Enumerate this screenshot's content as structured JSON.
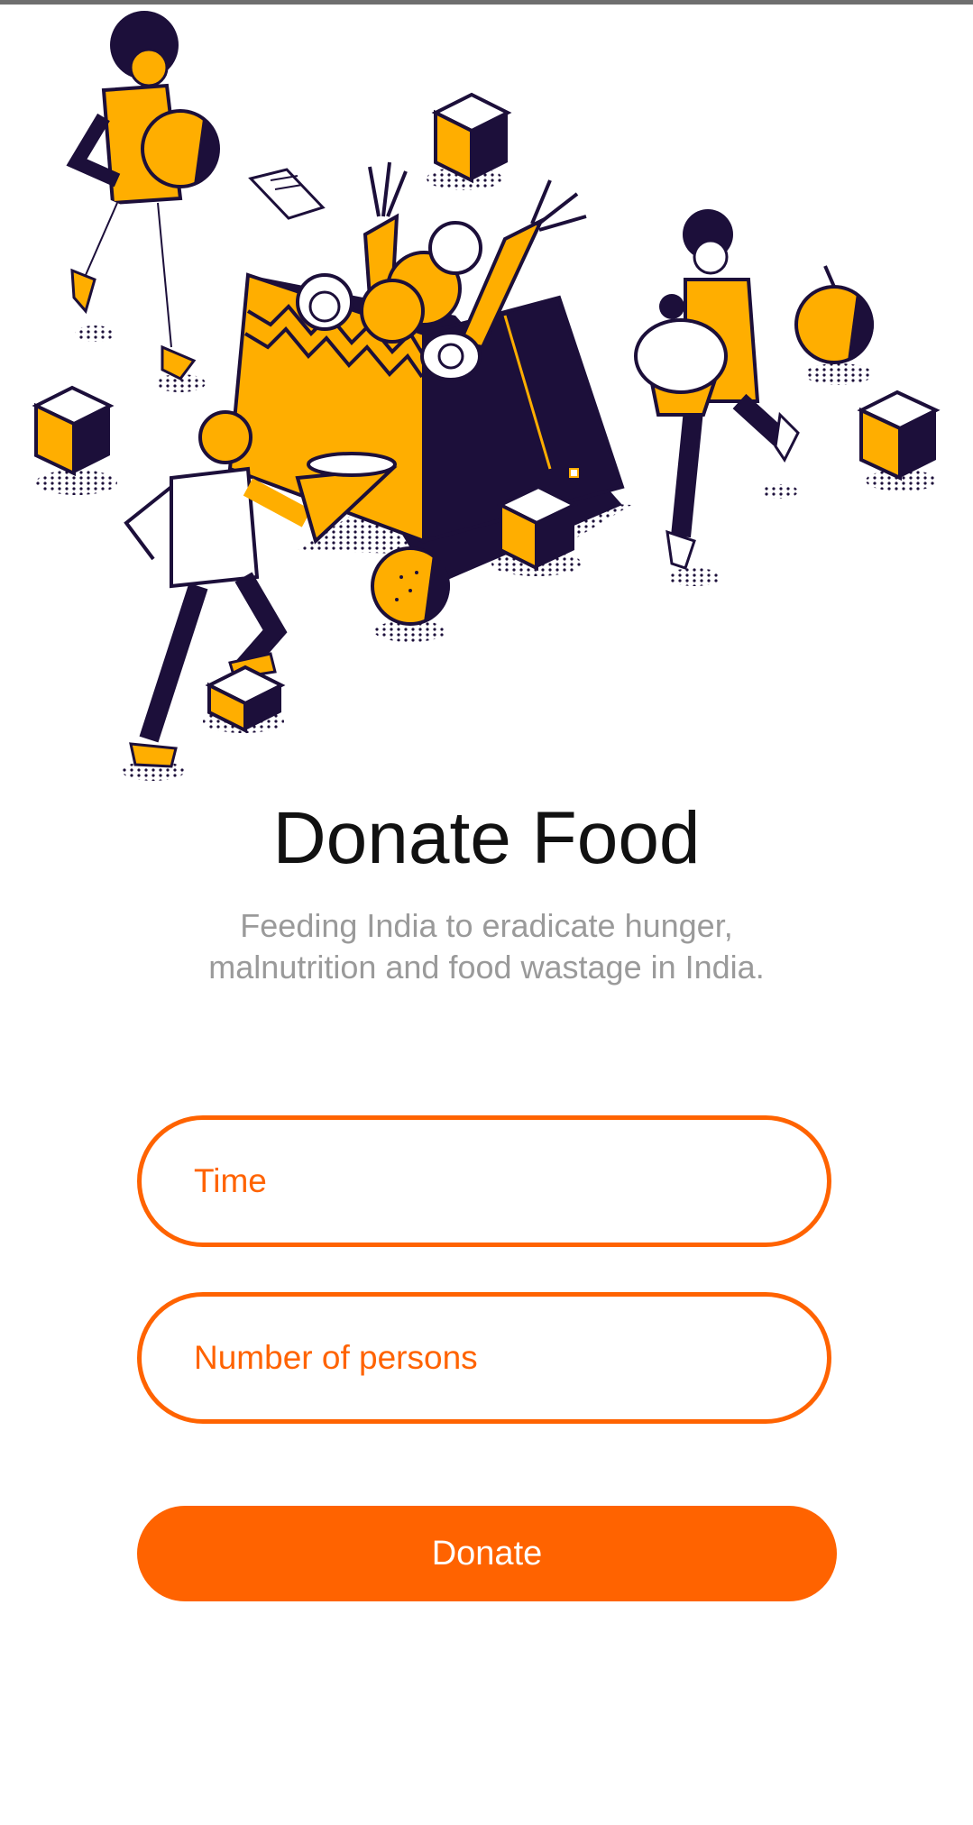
{
  "screen": {
    "title": "Donate Food",
    "subtitle_line1": "Feeding India to eradicate hunger,",
    "subtitle_line2": "malnutrition and food wastage in India."
  },
  "form": {
    "time_placeholder": "Time",
    "persons_placeholder": "Number of persons",
    "time_value": "",
    "persons_value": ""
  },
  "actions": {
    "donate_label": "Donate"
  },
  "colors": {
    "accent": "#FF6300",
    "illustration_yellow": "#FFAE00",
    "illustration_dark": "#1C0F3A",
    "title": "#111111",
    "subtitle": "#9A9A9A"
  },
  "illustration": {
    "name": "food-donation-illustration",
    "elements": [
      "shopping-bag-with-groceries",
      "person-with-orange",
      "person-with-cupcake",
      "person-with-pizza",
      "orange-fruit",
      "cardboard-box",
      "receipt"
    ]
  }
}
